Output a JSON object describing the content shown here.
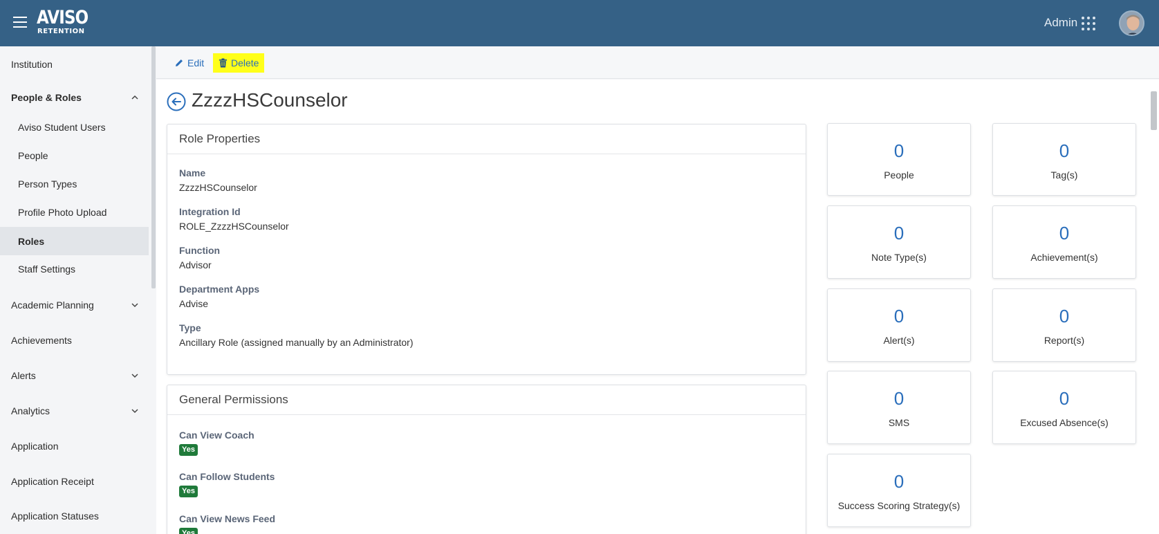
{
  "header": {
    "logo_main": "AVISO",
    "logo_sub": "RETENTION",
    "user_label": "Admin"
  },
  "sidebar": {
    "items": [
      {
        "label": "Institution"
      },
      {
        "label": "People & Roles",
        "expanded": true
      },
      {
        "label": "Aviso Student Users"
      },
      {
        "label": "People"
      },
      {
        "label": "Person Types"
      },
      {
        "label": "Profile Photo Upload"
      },
      {
        "label": "Roles",
        "active": true
      },
      {
        "label": "Staff Settings"
      },
      {
        "label": "Academic Planning"
      },
      {
        "label": "Achievements"
      },
      {
        "label": "Alerts"
      },
      {
        "label": "Analytics"
      },
      {
        "label": "Application"
      },
      {
        "label": "Application Receipt"
      },
      {
        "label": "Application Statuses"
      }
    ]
  },
  "toolbar": {
    "edit_label": "Edit",
    "delete_label": "Delete",
    "highlight_color": "#ffff1a"
  },
  "page": {
    "title": "ZzzzHSCounselor"
  },
  "role_properties": {
    "header": "Role Properties",
    "fields": [
      {
        "label": "Name",
        "value": "ZzzzHSCounselor"
      },
      {
        "label": "Integration Id",
        "value": "ROLE_ZzzzHSCounselor"
      },
      {
        "label": "Function",
        "value": "Advisor"
      },
      {
        "label": "Department Apps",
        "value": "Advise"
      },
      {
        "label": "Type",
        "value": "Ancillary Role (assigned manually by an Administrator)"
      }
    ]
  },
  "general_permissions": {
    "header": "General Permissions",
    "items": [
      {
        "label": "Can View Coach",
        "value": "Yes"
      },
      {
        "label": "Can Follow Students",
        "value": "Yes"
      },
      {
        "label": "Can View News Feed",
        "value": "Yes"
      }
    ]
  },
  "stats": [
    {
      "count": "0",
      "label": "People"
    },
    {
      "count": "0",
      "label": "Tag(s)"
    },
    {
      "count": "0",
      "label": "Note Type(s)"
    },
    {
      "count": "0",
      "label": "Achievement(s)"
    },
    {
      "count": "0",
      "label": "Alert(s)"
    },
    {
      "count": "0",
      "label": "Report(s)"
    },
    {
      "count": "0",
      "label": "SMS"
    },
    {
      "count": "0",
      "label": "Excused Absence(s)"
    },
    {
      "count": "0",
      "label": "Success Scoring Strategy(s)"
    }
  ],
  "colors": {
    "header_bg": "#356186",
    "link": "#2a6ebb",
    "badge_green": "#1f7a3a"
  }
}
